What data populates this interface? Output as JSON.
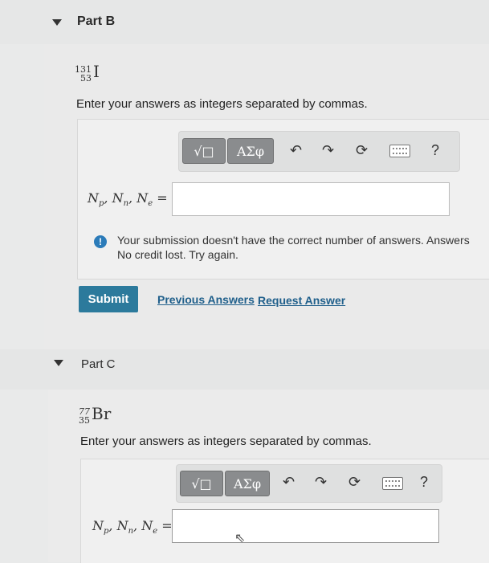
{
  "partB": {
    "title": "Part B",
    "nuclide": {
      "mass": "131",
      "atomic": "53",
      "symbol": "I"
    },
    "instruction": "Enter your answers as integers separated by commas.",
    "toolbar": {
      "sqrt_label": "√□",
      "greek_label": "ΑΣφ",
      "help": "?"
    },
    "eq_label": {
      "a": "N",
      "a_sub": "p",
      "b": "N",
      "b_sub": "n",
      "c": "N",
      "c_sub": "e",
      "equals": "="
    },
    "input_value": "",
    "feedback_line1": "Your submission doesn't have the correct number of answers. Answers",
    "feedback_line2": "No credit lost. Try again.",
    "submit": "Submit",
    "previous_answers": "Previous Answers",
    "request_answer": "Request Answer"
  },
  "partC": {
    "title": "Part C",
    "nuclide": {
      "mass": "77",
      "atomic": "35",
      "symbol": "Br"
    },
    "instruction": "Enter your answers as integers separated by commas.",
    "toolbar": {
      "sqrt_label": "√□",
      "greek_label": "ΑΣφ",
      "help": "?"
    },
    "eq_label": {
      "a": "N",
      "a_sub": "p",
      "b": "N",
      "b_sub": "n",
      "c": "N",
      "c_sub": "e",
      "equals": "="
    },
    "input_value": ""
  }
}
